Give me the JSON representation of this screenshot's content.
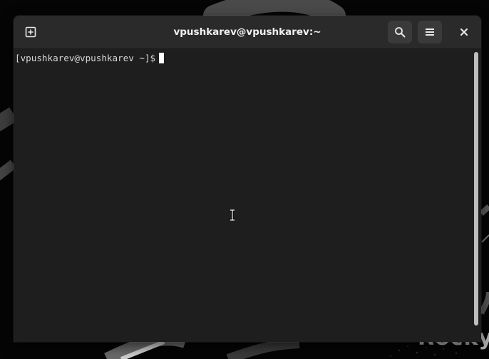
{
  "window": {
    "title": "vpushkarev@vpushkarev:~"
  },
  "terminal": {
    "prompt": "[vpushkarev@vpushkarev ~]$"
  },
  "headerbar": {
    "icons": {
      "new_tab": "new-tab-icon",
      "search": "search-icon",
      "menu": "hamburger-menu-icon",
      "close": "close-icon"
    }
  },
  "wallpaper": {
    "logo_text": "Rocky"
  },
  "colors": {
    "window_bg": "#1e1e1e",
    "headerbar_bg": "#2a2a2a",
    "button_bg": "#3a3a3a",
    "text": "#d8d8d8",
    "desktop_bg": "#050505"
  }
}
